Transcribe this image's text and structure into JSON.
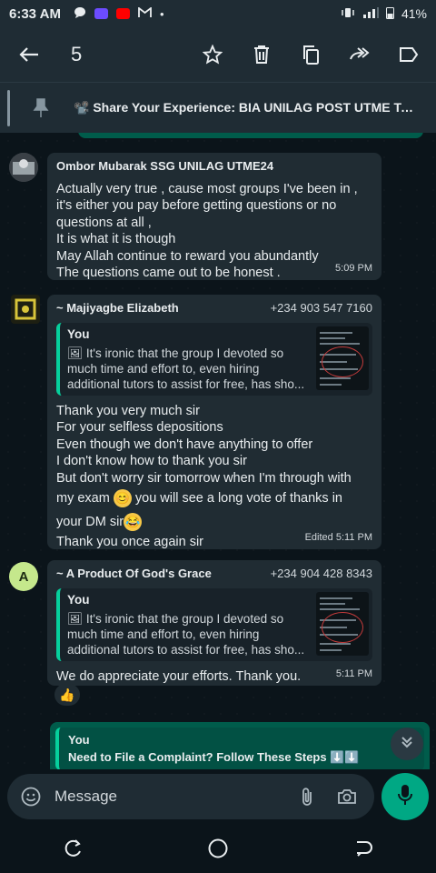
{
  "status_bar": {
    "time": "6:33 AM",
    "battery": "41%"
  },
  "toolbar": {
    "selected_count": "5"
  },
  "pinned": {
    "text": "📽️ Share Your Experience: BIA UNILAG POST UTME Tutorial..."
  },
  "messages": [
    {
      "sender": "Ombor Mubarak SSG UNILAG UTME24",
      "lines": [
        "Actually very true , cause most groups I've been in ,",
        "it's either you pay before getting questions or no",
        "questions at all ,",
        "It is what it is though",
        "May Allah continue to reward you abundantly",
        "The questions came out to be honest ."
      ],
      "time": "5:09 PM"
    },
    {
      "sender": "~ Majiyagbe Elizabeth",
      "phone": "+234 903 547 7160",
      "quote": {
        "author": "You",
        "lines": [
          "🖼 It's ironic that the group I devoted so",
          "much time and effort to, even hiring",
          "additional tutors to assist for free, has sho..."
        ]
      },
      "lines": [
        "Thank you very much sir",
        "For  your selfless depositions",
        "Even though we don't have anything to offer",
        "I don't know how to thank you sir",
        "But don't worry sir tomorrow when I'm through with",
        "my exam",
        "you will see a long vote of thanks in",
        "your DM sir",
        "Thank you once again sir"
      ],
      "emoji_smile": "😊",
      "emoji_laugh": "😂",
      "time": "Edited  5:11 PM"
    },
    {
      "sender": "~ A Product Of God's Grace",
      "phone": "+234 904 428 8343",
      "avatar_letter": "A",
      "quote": {
        "author": "You",
        "lines": [
          "🖼 It's ironic that the group I devoted so",
          "much time and effort to, even hiring",
          "additional tutors to assist for free, has sho..."
        ]
      },
      "lines": [
        "We do appreciate your efforts.  Thank you."
      ],
      "time": "5:11 PM",
      "reaction": "👍"
    }
  ],
  "outgoing_preview": {
    "author": "You",
    "text": "Need to File a Complaint? Follow These Steps ⬇️⬇️"
  },
  "composer": {
    "placeholder": "Message"
  },
  "colors": {
    "accent": "#00a884",
    "bubble": "#202c33",
    "outgoing": "#005c4b"
  }
}
